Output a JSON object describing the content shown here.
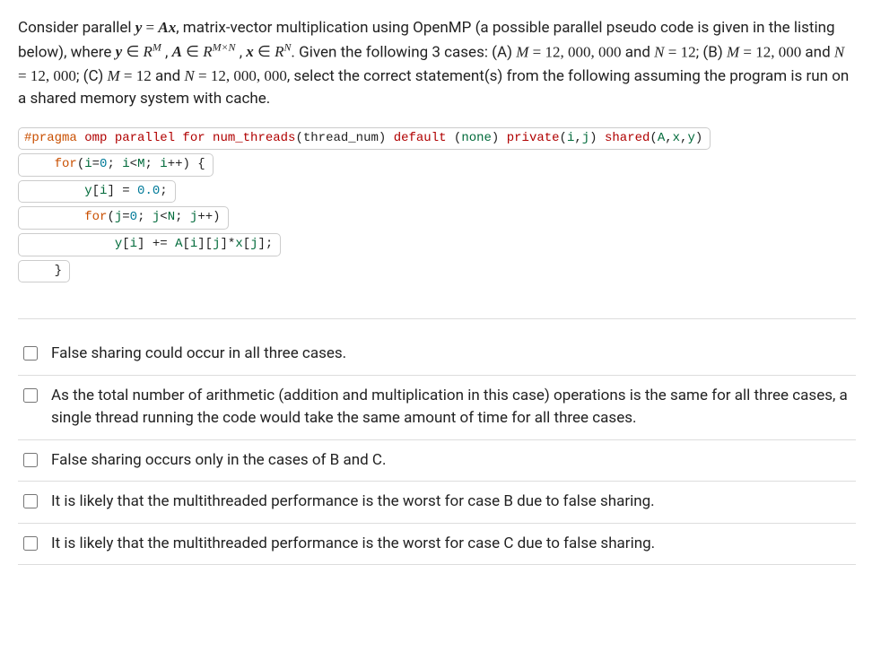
{
  "question": {
    "part1a": "Consider parallel ",
    "eq1": "y = Ax",
    "part1b": ", matrix-vector multiplication using OpenMP (a possible parallel pseudo code is given in the listing below), where ",
    "eq2": "y ∈ R",
    "eq2_sup": "M",
    "comma1": " , ",
    "eq3": "A ∈ R",
    "eq3_sup": "M×N",
    "comma2": " , ",
    "eq4": "x ∈ R",
    "eq4_sup": "N",
    "part1c": ". Given the following 3 cases: (A) ",
    "caseA": "M = 12, 000, 000",
    "andA": " and ",
    "caseA2": "N = 12",
    "part1d": "; (B) ",
    "caseB": "M = 12, 000",
    "andB": " and ",
    "caseB2": "N = 12, 000",
    "part1e": "; (C) ",
    "caseC": "M = 12",
    "andC": " and ",
    "caseC2": "N = 12, 000, 000",
    "part1f": ", select the correct statement(s) from the following assuming the program is run on a shared memory system with cache."
  },
  "code": {
    "l1": {
      "indent": "",
      "kw1": "#pragma",
      "sp1": " ",
      "fn1": "omp parallel for num_threads",
      "plain1": "(thread_num) ",
      "fn2": "default",
      "plain2": " (",
      "id1": "none",
      "plain3": ") ",
      "fn3": "private",
      "plain4": "(",
      "id2": "i",
      "plain5": ",",
      "id3": "j",
      "plain6": ") ",
      "fn4": "shared",
      "plain7": "(",
      "id4": "A",
      "plain8": ",",
      "id5": "x",
      "plain9": ",",
      "id6": "y",
      "plain10": ")"
    },
    "l2": {
      "indent": "    ",
      "kw1": "for",
      "plain1": "(",
      "id1": "i",
      "plain2": "=",
      "num1": "0",
      "plain3": "; ",
      "id2": "i",
      "plain4": "<",
      "id3": "M",
      "plain5": "; ",
      "id4": "i",
      "plain6": "++) {"
    },
    "l3": {
      "indent": "        ",
      "id1": "y",
      "plain1": "[",
      "id2": "i",
      "plain2": "] = ",
      "num1": "0.0",
      "plain3": ";"
    },
    "l4": {
      "indent": "        ",
      "kw1": "for",
      "plain1": "(",
      "id1": "j",
      "plain2": "=",
      "num1": "0",
      "plain3": "; ",
      "id2": "j",
      "plain4": "<",
      "id3": "N",
      "plain5": "; ",
      "id4": "j",
      "plain6": "++)"
    },
    "l5": {
      "indent": "            ",
      "id1": "y",
      "plain1": "[",
      "id2": "i",
      "plain2": "] += ",
      "id3": "A",
      "plain3": "[",
      "id4": "i",
      "plain4": "][",
      "id5": "j",
      "plain5": "]*",
      "id6": "x",
      "plain6": "[",
      "id7": "j",
      "plain7": "];"
    },
    "l6": {
      "indent": "    ",
      "plain1": "}"
    }
  },
  "answers": [
    {
      "text": "False sharing could occur in all three cases."
    },
    {
      "text": "As the total number of arithmetic (addition and multiplication in this case) operations is the same for all three cases, a single thread running the code would take the same amount of time for all three cases."
    },
    {
      "text": "False sharing occurs only in the cases of B and C."
    },
    {
      "text": "It is likely that the multithreaded performance is the worst for case B due to false sharing."
    },
    {
      "text": "It is likely that the multithreaded performance is the worst for case C due to false sharing."
    }
  ]
}
